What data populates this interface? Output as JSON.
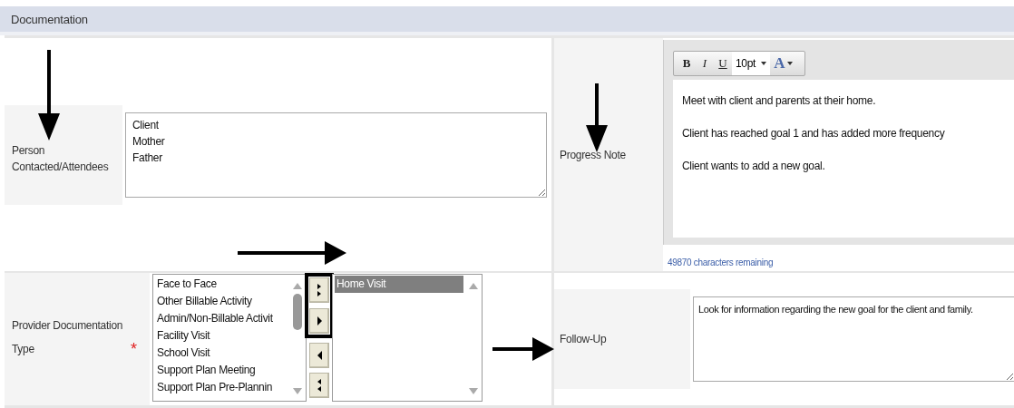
{
  "section": {
    "title": "Documentation"
  },
  "person_contacted": {
    "label": "Person Contacted/Attendees",
    "value": "Client\nMother\nFather"
  },
  "progress_note": {
    "label": "Progress Note",
    "toolbar": [
      {
        "kind": "bold",
        "label": "B"
      },
      {
        "kind": "italic",
        "label": "I"
      },
      {
        "kind": "underline",
        "label": "U"
      },
      {
        "kind": "size",
        "label": "10pt"
      },
      {
        "kind": "color",
        "label": "A"
      }
    ],
    "paragraphs": [
      "Meet with client and parents at their home.",
      "Client has reached goal 1 and has added more frequency",
      "Client wants to add a new goal."
    ],
    "counter": "49870 characters remaining"
  },
  "provider_type": {
    "label": "Provider Documentation Type",
    "required_mark": "*",
    "available": [
      {
        "label": "Face to Face",
        "selected": false
      },
      {
        "label": "Other Billable Activity",
        "selected": false
      },
      {
        "label": "Admin/Non-Billable Activit",
        "selected": false
      },
      {
        "label": "Facility Visit",
        "selected": false
      },
      {
        "label": "School Visit",
        "selected": false
      },
      {
        "label": "Support Plan Meeting",
        "selected": false
      },
      {
        "label": "Support Plan Pre-Plannin",
        "selected": false
      }
    ],
    "transfer_buttons": [
      {
        "kind": "add_all",
        "highlighted": true
      },
      {
        "kind": "add",
        "highlighted": true
      },
      {
        "kind": "remove",
        "highlighted": false
      },
      {
        "kind": "remove_all",
        "highlighted": false
      }
    ],
    "chosen": [
      {
        "label": "Home Visit",
        "selected": true
      }
    ]
  },
  "follow_up": {
    "label": "Follow-Up",
    "value": "Look for information regarding the new goal for the client and family."
  }
}
